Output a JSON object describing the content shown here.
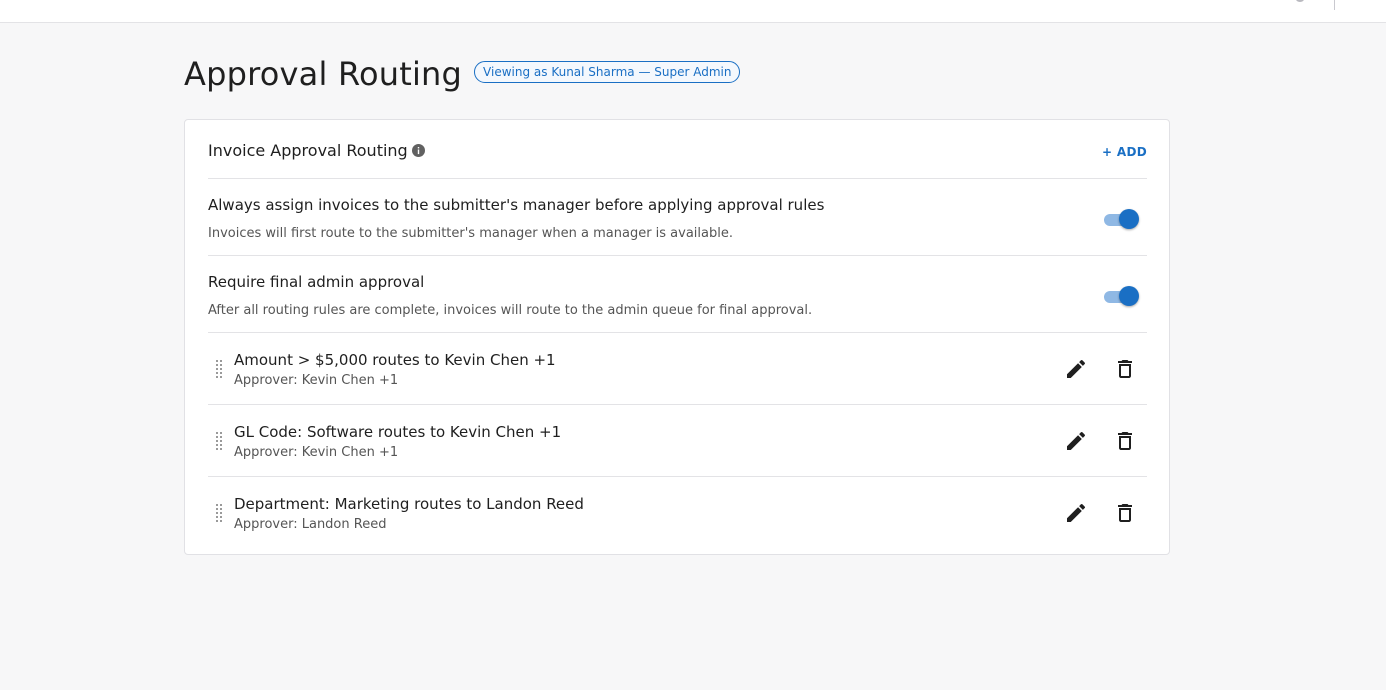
{
  "page": {
    "title": "Approval Routing",
    "viewing_badge": "Viewing as Kunal Sharma — Super Admin"
  },
  "card": {
    "title": "Invoice Approval Routing",
    "add_label": "+ ADD",
    "settings": [
      {
        "title": "Always assign invoices to the submitter's manager before applying approval rules",
        "description": "Invoices will first route to the submitter's manager when a manager is available.",
        "enabled": true
      },
      {
        "title": "Require final admin approval",
        "description": "After all routing rules are complete, invoices will route to the admin queue for final approval.",
        "enabled": true
      }
    ],
    "rules": [
      {
        "title": "Amount > $5,000 routes to Kevin Chen +1",
        "approver": "Approver: Kevin Chen +1"
      },
      {
        "title": "GL Code: Software routes to Kevin Chen +1",
        "approver": "Approver: Kevin Chen +1"
      },
      {
        "title": "Department: Marketing routes to Landon Reed",
        "approver": "Approver: Landon Reed"
      }
    ]
  },
  "icons": {
    "info": "info-icon",
    "drag": "drag-handle-icon",
    "edit": "pencil-icon",
    "delete": "trash-icon"
  },
  "colors": {
    "accent": "#1a6fc4",
    "toggle_track": "#8fb8e4"
  }
}
